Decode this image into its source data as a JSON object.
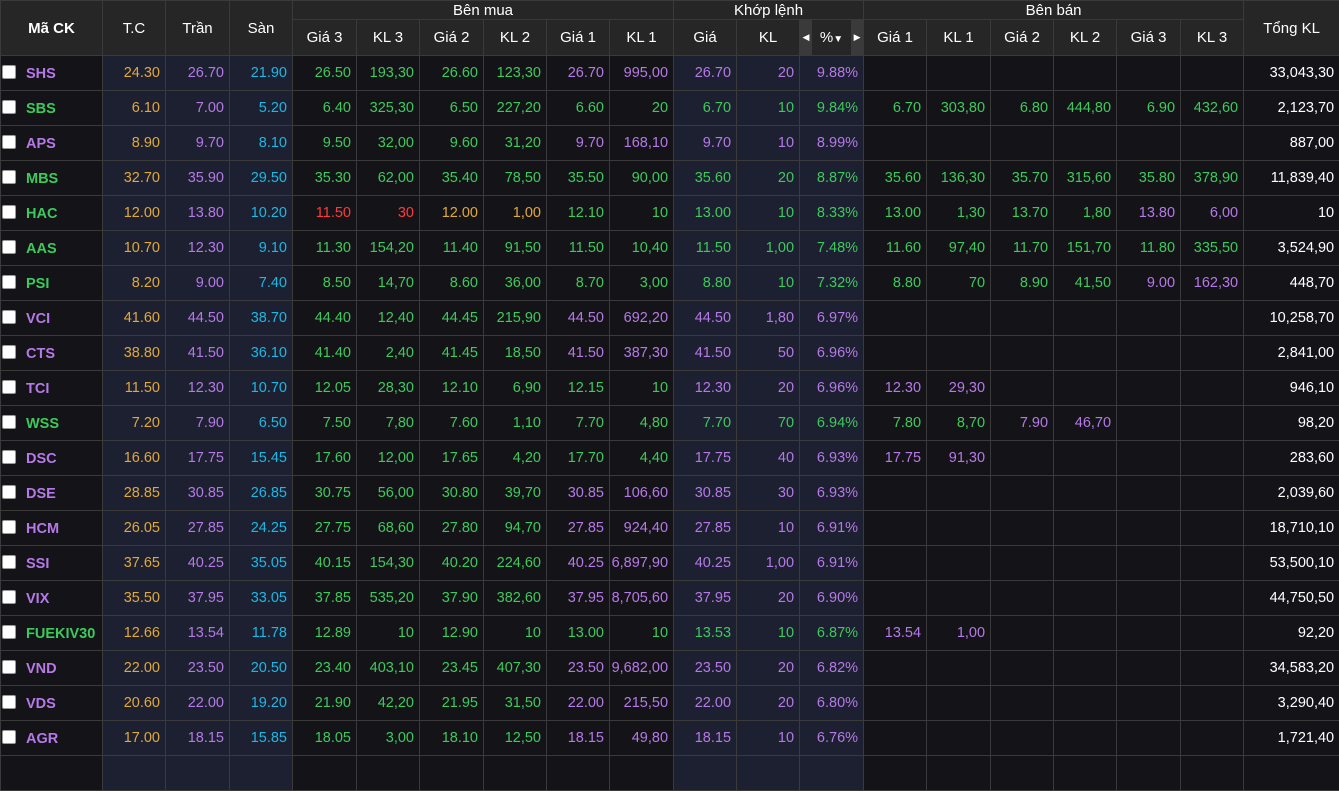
{
  "colors": {
    "ceil": "#b679e8",
    "floor": "#1db8e6",
    "ref": "#e0a93c",
    "up": "#3ec95c",
    "down": "#ff3b3b",
    "white": "#ffffff"
  },
  "header": {
    "symbol": "Mã CK",
    "ref": "T.C",
    "ceil": "Trần",
    "floor": "Sàn",
    "buy_group": "Bên mua",
    "match_group": "Khớp lệnh",
    "sell_group": "Bên bán",
    "total": "Tổng KL",
    "buy_cols": [
      "Giá 3",
      "KL 3",
      "Giá 2",
      "KL 2",
      "Giá 1",
      "KL 1"
    ],
    "match_cols": [
      "Giá",
      "KL",
      "%"
    ],
    "sell_cols": [
      "Giá 1",
      "KL 1",
      "Giá 2",
      "KL 2",
      "Giá 3",
      "KL 3"
    ],
    "pct_sort_icon": "caret-down-icon"
  },
  "rows": [
    {
      "sym": "SHS",
      "tc": "24.30",
      "ceil": "26.70",
      "floor": "21.90",
      "buy": [
        "26.50",
        "193,30",
        "26.60",
        "123,30",
        "26.70",
        "995,00"
      ],
      "match": [
        "26.70",
        "20",
        "9.88%"
      ],
      "sell": [
        "",
        "",
        "",
        "",
        "",
        ""
      ],
      "total": "33,043,30"
    },
    {
      "sym": "SBS",
      "tc": "6.10",
      "ceil": "7.00",
      "floor": "5.20",
      "buy": [
        "6.40",
        "325,30",
        "6.50",
        "227,20",
        "6.60",
        "20"
      ],
      "match": [
        "6.70",
        "10",
        "9.84%"
      ],
      "sell": [
        "6.70",
        "303,80",
        "6.80",
        "444,80",
        "6.90",
        "432,60"
      ],
      "total": "2,123,70"
    },
    {
      "sym": "APS",
      "tc": "8.90",
      "ceil": "9.70",
      "floor": "8.10",
      "buy": [
        "9.50",
        "32,00",
        "9.60",
        "31,20",
        "9.70",
        "168,10"
      ],
      "match": [
        "9.70",
        "10",
        "8.99%"
      ],
      "sell": [
        "",
        "",
        "",
        "",
        "",
        ""
      ],
      "total": "887,00"
    },
    {
      "sym": "MBS",
      "tc": "32.70",
      "ceil": "35.90",
      "floor": "29.50",
      "buy": [
        "35.30",
        "62,00",
        "35.40",
        "78,50",
        "35.50",
        "90,00"
      ],
      "match": [
        "35.60",
        "20",
        "8.87%"
      ],
      "sell": [
        "35.60",
        "136,30",
        "35.70",
        "315,60",
        "35.80",
        "378,90"
      ],
      "total": "11,839,40"
    },
    {
      "sym": "HAC",
      "tc": "12.00",
      "ceil": "13.80",
      "floor": "10.20",
      "buy": [
        "11.50",
        "30",
        "12.00",
        "1,00",
        "12.10",
        "10"
      ],
      "match": [
        "13.00",
        "10",
        "8.33%"
      ],
      "sell": [
        "13.00",
        "1,30",
        "13.70",
        "1,80",
        "13.80",
        "6,00"
      ],
      "total": "10"
    },
    {
      "sym": "AAS",
      "tc": "10.70",
      "ceil": "12.30",
      "floor": "9.10",
      "buy": [
        "11.30",
        "154,20",
        "11.40",
        "91,50",
        "11.50",
        "10,40"
      ],
      "match": [
        "11.50",
        "1,00",
        "7.48%"
      ],
      "sell": [
        "11.60",
        "97,40",
        "11.70",
        "151,70",
        "11.80",
        "335,50"
      ],
      "total": "3,524,90"
    },
    {
      "sym": "PSI",
      "tc": "8.20",
      "ceil": "9.00",
      "floor": "7.40",
      "buy": [
        "8.50",
        "14,70",
        "8.60",
        "36,00",
        "8.70",
        "3,00"
      ],
      "match": [
        "8.80",
        "10",
        "7.32%"
      ],
      "sell": [
        "8.80",
        "70",
        "8.90",
        "41,50",
        "9.00",
        "162,30"
      ],
      "total": "448,70"
    },
    {
      "sym": "VCI",
      "tc": "41.60",
      "ceil": "44.50",
      "floor": "38.70",
      "buy": [
        "44.40",
        "12,40",
        "44.45",
        "215,90",
        "44.50",
        "692,20"
      ],
      "match": [
        "44.50",
        "1,80",
        "6.97%"
      ],
      "sell": [
        "",
        "",
        "",
        "",
        "",
        ""
      ],
      "total": "10,258,70"
    },
    {
      "sym": "CTS",
      "tc": "38.80",
      "ceil": "41.50",
      "floor": "36.10",
      "buy": [
        "41.40",
        "2,40",
        "41.45",
        "18,50",
        "41.50",
        "387,30"
      ],
      "match": [
        "41.50",
        "50",
        "6.96%"
      ],
      "sell": [
        "",
        "",
        "",
        "",
        "",
        ""
      ],
      "total": "2,841,00"
    },
    {
      "sym": "TCI",
      "tc": "11.50",
      "ceil": "12.30",
      "floor": "10.70",
      "buy": [
        "12.05",
        "28,30",
        "12.10",
        "6,90",
        "12.15",
        "10"
      ],
      "match": [
        "12.30",
        "20",
        "6.96%"
      ],
      "sell": [
        "12.30",
        "29,30",
        "",
        "",
        "",
        ""
      ],
      "total": "946,10"
    },
    {
      "sym": "WSS",
      "tc": "7.20",
      "ceil": "7.90",
      "floor": "6.50",
      "buy": [
        "7.50",
        "7,80",
        "7.60",
        "1,10",
        "7.70",
        "4,80"
      ],
      "match": [
        "7.70",
        "70",
        "6.94%"
      ],
      "sell": [
        "7.80",
        "8,70",
        "7.90",
        "46,70",
        "",
        ""
      ],
      "total": "98,20"
    },
    {
      "sym": "DSC",
      "tc": "16.60",
      "ceil": "17.75",
      "floor": "15.45",
      "buy": [
        "17.60",
        "12,00",
        "17.65",
        "4,20",
        "17.70",
        "4,40"
      ],
      "match": [
        "17.75",
        "40",
        "6.93%"
      ],
      "sell": [
        "17.75",
        "91,30",
        "",
        "",
        "",
        ""
      ],
      "total": "283,60"
    },
    {
      "sym": "DSE",
      "tc": "28.85",
      "ceil": "30.85",
      "floor": "26.85",
      "buy": [
        "30.75",
        "56,00",
        "30.80",
        "39,70",
        "30.85",
        "106,60"
      ],
      "match": [
        "30.85",
        "30",
        "6.93%"
      ],
      "sell": [
        "",
        "",
        "",
        "",
        "",
        ""
      ],
      "total": "2,039,60"
    },
    {
      "sym": "HCM",
      "tc": "26.05",
      "ceil": "27.85",
      "floor": "24.25",
      "buy": [
        "27.75",
        "68,60",
        "27.80",
        "94,70",
        "27.85",
        "924,40"
      ],
      "match": [
        "27.85",
        "10",
        "6.91%"
      ],
      "sell": [
        "",
        "",
        "",
        "",
        "",
        ""
      ],
      "total": "18,710,10"
    },
    {
      "sym": "SSI",
      "tc": "37.65",
      "ceil": "40.25",
      "floor": "35.05",
      "buy": [
        "40.15",
        "154,30",
        "40.20",
        "224,60",
        "40.25",
        "6,897,90"
      ],
      "match": [
        "40.25",
        "1,00",
        "6.91%"
      ],
      "sell": [
        "",
        "",
        "",
        "",
        "",
        ""
      ],
      "total": "53,500,10"
    },
    {
      "sym": "VIX",
      "tc": "35.50",
      "ceil": "37.95",
      "floor": "33.05",
      "buy": [
        "37.85",
        "535,20",
        "37.90",
        "382,60",
        "37.95",
        "8,705,60"
      ],
      "match": [
        "37.95",
        "20",
        "6.90%"
      ],
      "sell": [
        "",
        "",
        "",
        "",
        "",
        ""
      ],
      "total": "44,750,50"
    },
    {
      "sym": "FUEKIV30",
      "tc": "12.66",
      "ceil": "13.54",
      "floor": "11.78",
      "buy": [
        "12.89",
        "10",
        "12.90",
        "10",
        "13.00",
        "10"
      ],
      "match": [
        "13.53",
        "10",
        "6.87%"
      ],
      "sell": [
        "13.54",
        "1,00",
        "",
        "",
        "",
        ""
      ],
      "total": "92,20"
    },
    {
      "sym": "VND",
      "tc": "22.00",
      "ceil": "23.50",
      "floor": "20.50",
      "buy": [
        "23.40",
        "403,10",
        "23.45",
        "407,30",
        "23.50",
        "9,682,00"
      ],
      "match": [
        "23.50",
        "20",
        "6.82%"
      ],
      "sell": [
        "",
        "",
        "",
        "",
        "",
        ""
      ],
      "total": "34,583,20"
    },
    {
      "sym": "VDS",
      "tc": "20.60",
      "ceil": "22.00",
      "floor": "19.20",
      "buy": [
        "21.90",
        "42,20",
        "21.95",
        "31,50",
        "22.00",
        "215,50"
      ],
      "match": [
        "22.00",
        "20",
        "6.80%"
      ],
      "sell": [
        "",
        "",
        "",
        "",
        "",
        ""
      ],
      "total": "3,290,40"
    },
    {
      "sym": "AGR",
      "tc": "17.00",
      "ceil": "18.15",
      "floor": "15.85",
      "buy": [
        "18.05",
        "3,00",
        "18.10",
        "12,50",
        "18.15",
        "49,80"
      ],
      "match": [
        "18.15",
        "10",
        "6.76%"
      ],
      "sell": [
        "",
        "",
        "",
        "",
        "",
        ""
      ],
      "total": "1,721,40"
    }
  ]
}
